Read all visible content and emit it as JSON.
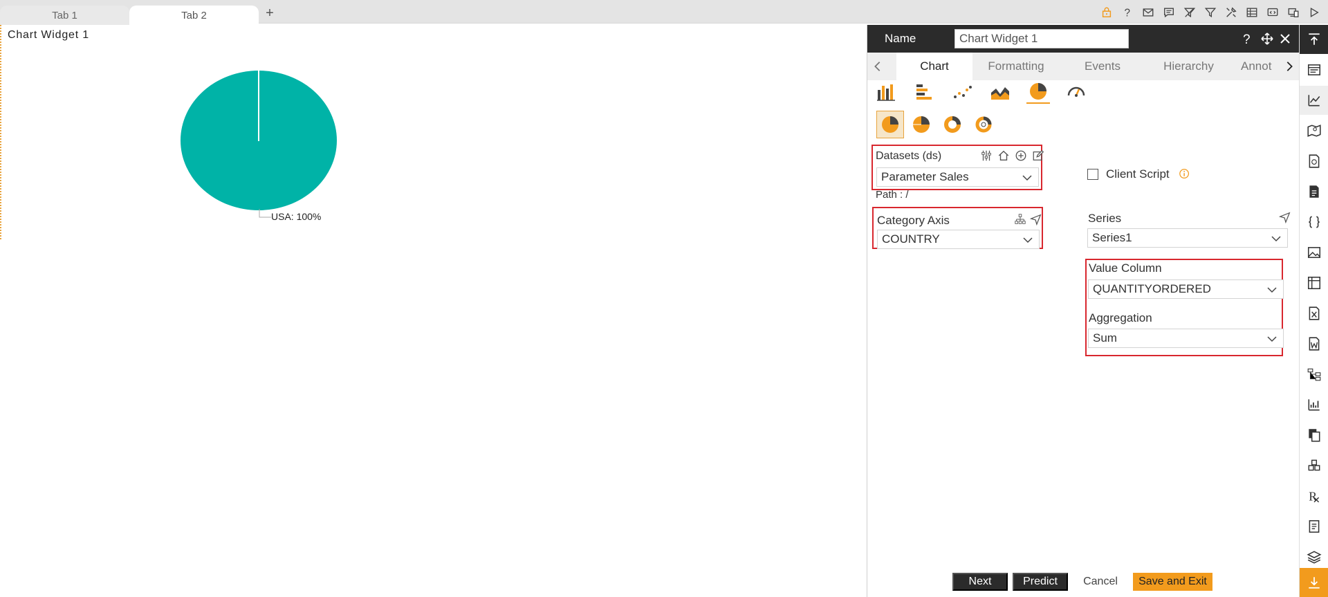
{
  "tabs": [
    {
      "label": "Tab 1",
      "active": false
    },
    {
      "label": "Tab 2",
      "active": true
    }
  ],
  "add_tab_label": "+",
  "toolbar_icons": [
    "lock-icon",
    "help-icon",
    "mail-icon",
    "comment-icon",
    "clear-filter-icon",
    "filter-icon",
    "tools-icon",
    "table-icon",
    "embed-icon",
    "devices-icon",
    "play-icon"
  ],
  "widget": {
    "title": "Chart Widget 1",
    "pie_label": "USA: 100%",
    "pie_color": "#00b3a7"
  },
  "panel": {
    "name_label": "Name",
    "name_value": "Chart Widget 1",
    "tabs": [
      "Chart",
      "Formatting",
      "Events",
      "Hierarchy",
      "Annot"
    ],
    "active_tab": "Chart",
    "datasets": {
      "label": "Datasets (ds)",
      "selected": "Parameter Sales",
      "path": "Path : /"
    },
    "client_script_label": "Client Script",
    "category_axis": {
      "label": "Category Axis",
      "selected": "COUNTRY"
    },
    "series": {
      "label": "Series",
      "selected": "Series1"
    },
    "value_column": {
      "label": "Value Column",
      "selected": "QUANTITYORDERED"
    },
    "aggregation": {
      "label": "Aggregation",
      "selected": "Sum"
    }
  },
  "buttons": {
    "next": "Next",
    "predict": "Predict",
    "cancel": "Cancel",
    "save_exit": "Save and Exit"
  },
  "colors": {
    "accent": "#f29b1d",
    "dark": "#2b2b2b",
    "highlight": "#d8272e",
    "pie": "#00b3a7"
  }
}
